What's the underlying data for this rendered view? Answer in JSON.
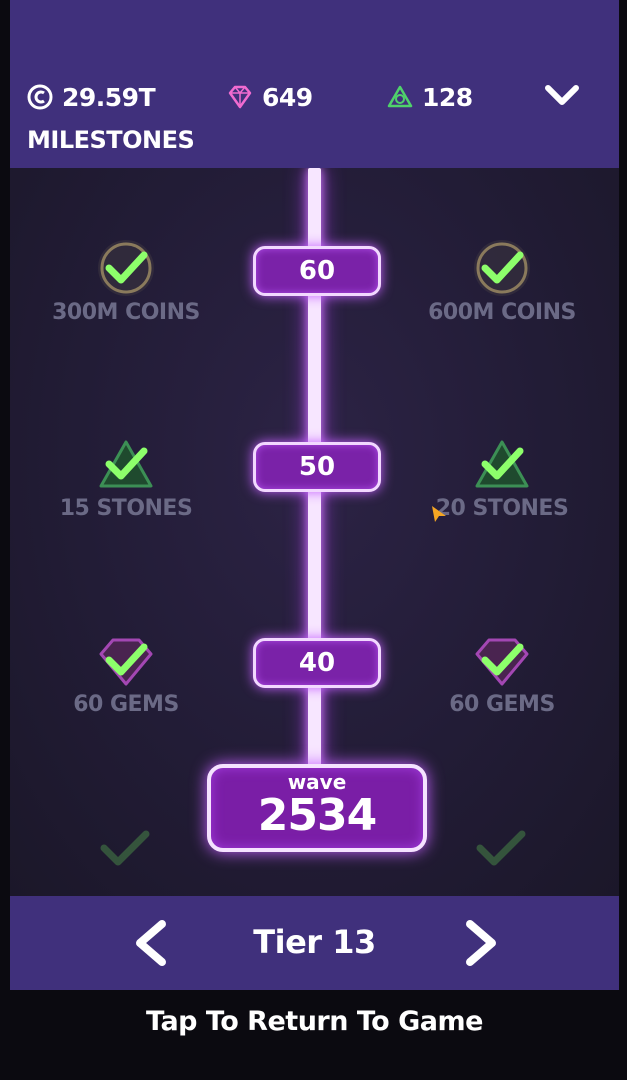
{
  "header": {
    "coins": "29.59T",
    "gems": "649",
    "stones": "128",
    "title": "MILESTONES"
  },
  "milestones": [
    {
      "tier": "60",
      "left": {
        "label": "300M COINS",
        "icon": "coin-check-icon"
      },
      "right": {
        "label": "600M COINS",
        "icon": "coin-check-icon"
      }
    },
    {
      "tier": "50",
      "left": {
        "label": "15 STONES",
        "icon": "stone-check-icon"
      },
      "right": {
        "label": "20 STONES",
        "icon": "stone-check-icon"
      }
    },
    {
      "tier": "40",
      "left": {
        "label": "60 GEMS",
        "icon": "gem-check-icon"
      },
      "right": {
        "label": "60 GEMS",
        "icon": "gem-check-icon"
      }
    }
  ],
  "wave": {
    "label": "wave",
    "value": "2534"
  },
  "tier_nav": {
    "label": "Tier 13"
  },
  "footer": {
    "return_label": "Tap To Return To Game"
  },
  "colors": {
    "header_bg": "#40307c",
    "check": "#8dff6b",
    "pill": "#7a22a8",
    "rail_glow": "#d47bff"
  }
}
